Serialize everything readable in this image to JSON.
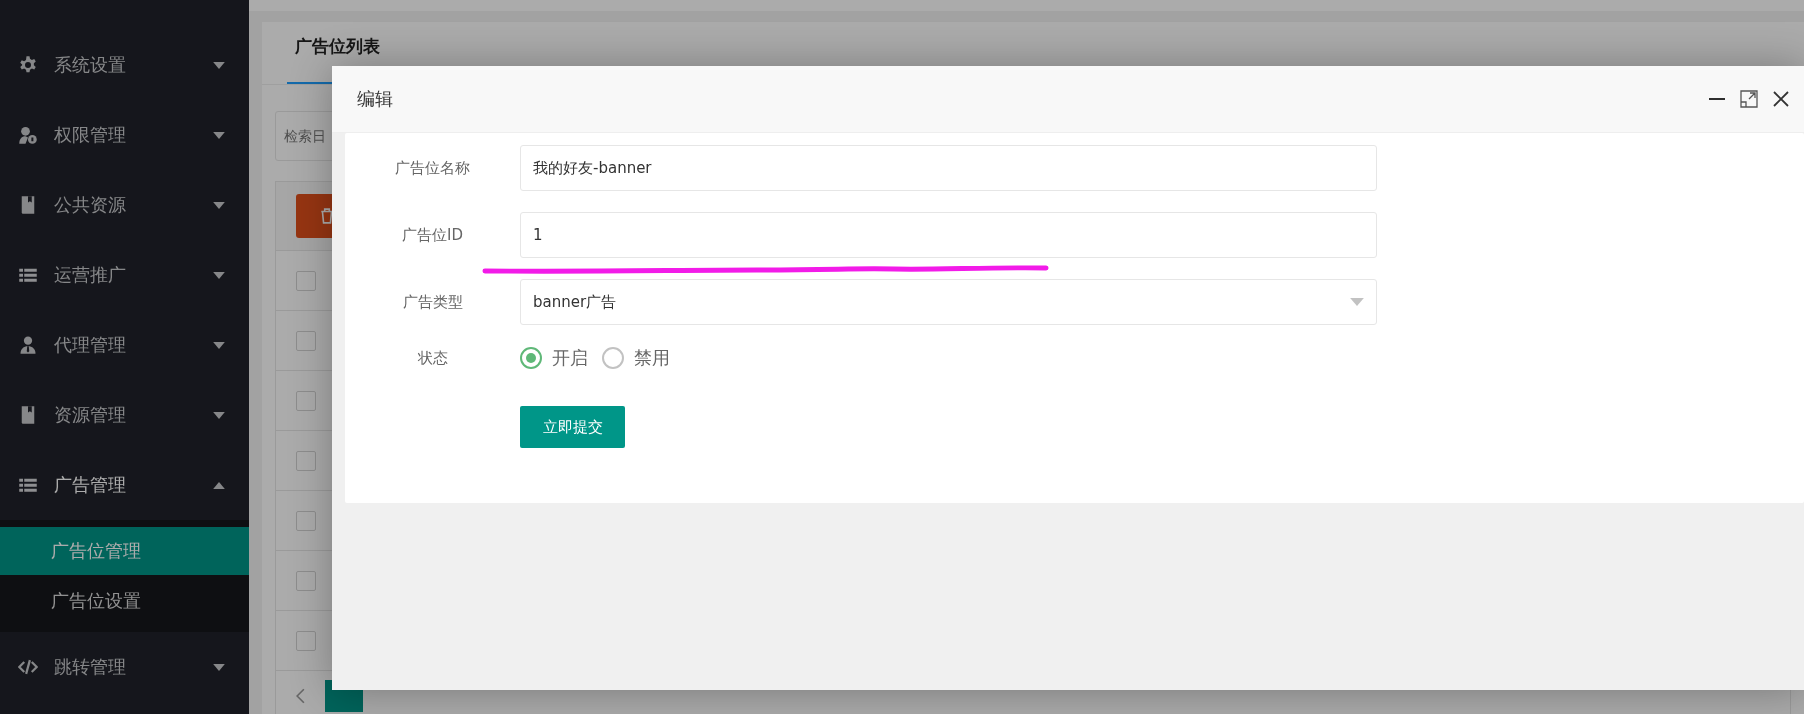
{
  "sidebar": {
    "items": [
      {
        "label": "系统设置",
        "kind": "gear",
        "expanded": false
      },
      {
        "label": "权限管理",
        "kind": "user-key",
        "expanded": false
      },
      {
        "label": "公共资源",
        "kind": "book",
        "expanded": false
      },
      {
        "label": "运营推广",
        "kind": "list",
        "expanded": false
      },
      {
        "label": "代理管理",
        "kind": "person",
        "expanded": false
      },
      {
        "label": "资源管理",
        "kind": "book",
        "expanded": false
      },
      {
        "label": "广告管理",
        "kind": "list",
        "expanded": true,
        "children": [
          {
            "label": "广告位管理",
            "selected": true
          },
          {
            "label": "广告位设置",
            "selected": false
          }
        ]
      },
      {
        "label": "跳转管理",
        "kind": "code",
        "expanded": false
      }
    ]
  },
  "page": {
    "tab": "广告位列表",
    "search": {
      "placeholder": "检索日"
    },
    "table": {
      "header_checked": false,
      "rows": [
        {
          "checked": false
        },
        {
          "checked": false
        },
        {
          "checked": false
        },
        {
          "checked": false
        },
        {
          "checked": false
        },
        {
          "checked": false
        }
      ]
    }
  },
  "dialog": {
    "title": "编辑",
    "fields": [
      {
        "kind": "text",
        "label": "广告位名称",
        "value": "我的好友-banner"
      },
      {
        "kind": "text",
        "label": "广告位ID",
        "value": "1"
      },
      {
        "kind": "select",
        "label": "广告类型",
        "value": "banner广告"
      },
      {
        "kind": "radio",
        "label": "状态",
        "options": [
          {
            "label": "开启",
            "selected": true
          },
          {
            "label": "禁用",
            "selected": false
          }
        ]
      }
    ],
    "submit": "立即提交"
  }
}
